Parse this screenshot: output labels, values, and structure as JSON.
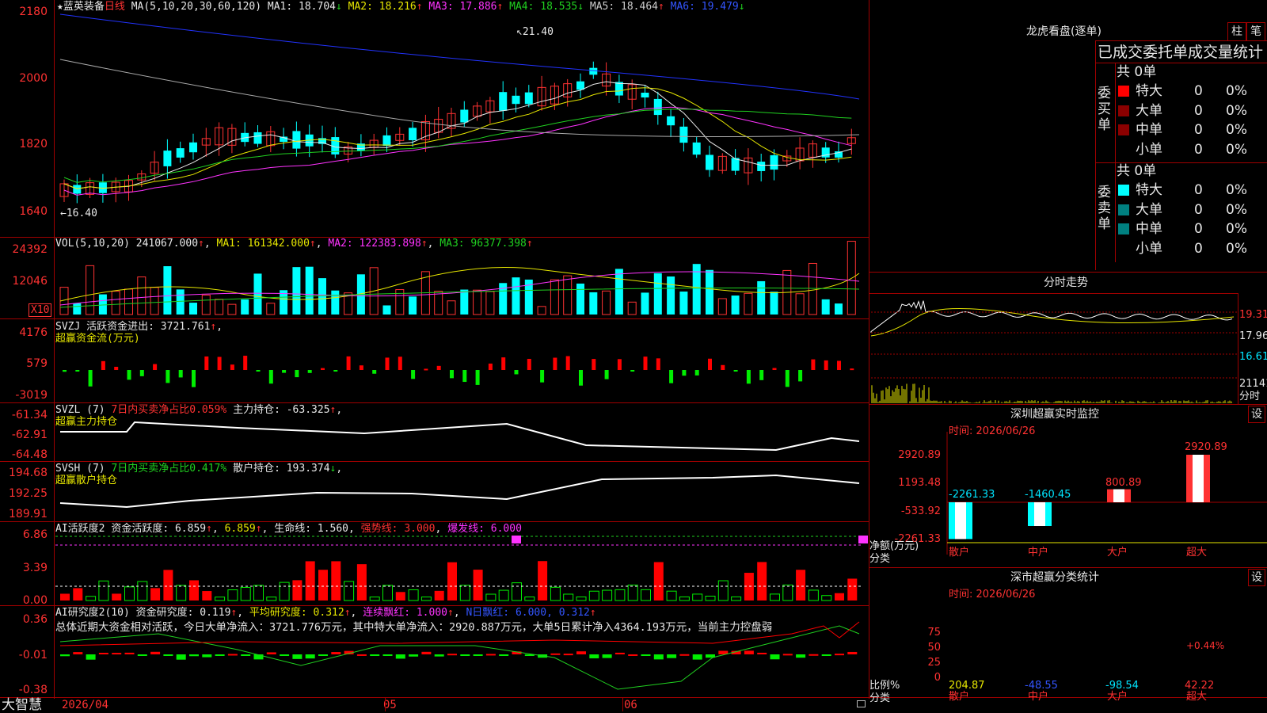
{
  "header": {
    "star": "★",
    "stock_name": "蓝英装备",
    "period": "日线",
    "ma_label": "MA(5,10,20,30,60,120)",
    "ma_values": [
      {
        "label": "MA1:",
        "value": "18.704",
        "arrow": "↓",
        "color": "#e8e8e8"
      },
      {
        "label": "MA2:",
        "value": "18.216",
        "arrow": "↑",
        "color": "#e6e600"
      },
      {
        "label": "MA3:",
        "value": "17.886",
        "arrow": "↑",
        "color": "#ff33ff"
      },
      {
        "label": "MA4:",
        "value": "18.535",
        "arrow": "↓",
        "color": "#20d020"
      },
      {
        "label": "MA5:",
        "value": "18.464",
        "arrow": "↑",
        "color": "#cccccc"
      },
      {
        "label": "MA6:",
        "value": "19.479",
        "arrow": "↓",
        "color": "#3355ff"
      }
    ],
    "high_mark": "21.40",
    "low_mark": "16.40"
  },
  "price_axis": [
    "2180",
    "2000",
    "1820",
    "1640"
  ],
  "vol": {
    "label": "VOL(5,10,20)",
    "value": "241067.000",
    "ma1": "MA1: 161342.000",
    "ma2": "MA2: 122383.898",
    "ma3": "MA3: 96377.398",
    "axis": [
      "24392",
      "12046"
    ],
    "unit": "X10"
  },
  "svzj": {
    "label": "SVZJ",
    "desc": "活跃资金进出: 3721.761",
    "sub": "超赢资金流(万元)",
    "axis": [
      "4176",
      "579",
      "-3019"
    ]
  },
  "svzl": {
    "label": "SVZL (7)",
    "ratio": "7日内买卖净占比0.059%",
    "hold": "主力持仓: -63.325",
    "sub": "超赢主力持仓",
    "axis": [
      "-61.34",
      "-62.91",
      "-64.48"
    ]
  },
  "svsh": {
    "label": "SVSH (7)",
    "ratio": "7日内买卖净占比0.417%",
    "hold": "散户持仓: 193.374",
    "sub": "超赢散户持仓",
    "axis": [
      "194.68",
      "192.25",
      "189.91"
    ]
  },
  "ai_active": {
    "label": "AI活跃度2",
    "desc": "资金活跃度: 6.859",
    "v2": "6.859",
    "life": "生命线: 1.560",
    "strong": "强势线: 3.000",
    "burst": "爆发线: 6.000",
    "axis": [
      "6.86",
      "3.39",
      "0.00"
    ]
  },
  "ai_research": {
    "label": "AI研究度2(10)",
    "desc": "资金研究度: 0.119",
    "avg": "平均研究度: 0.312",
    "cont": "连续飘红: 1.000",
    "nday": "N日飘红: 6.000, 0.312",
    "summary": "总体近期大资金相对活跃，今日大单净流入：3721.776万元，其中特大单净流入：2920.887万元，大单5日累计净入4364.193万元，当前主力控盘弱",
    "axis": [
      "0.36",
      "-0.01",
      "-0.38"
    ]
  },
  "footer": {
    "brand": "大智慧",
    "date": "2026/04",
    "m05": "05",
    "m06": "06"
  },
  "right": {
    "title": "龙虎看盘(逐单)",
    "btn_zhu": "柱",
    "btn_bi": "笔",
    "stats_title": "已成交委托单成交量统计",
    "buy_label": "委买单",
    "sell_label": "委卖单",
    "buy_total": "共 0单",
    "sell_total": "共 0单",
    "rows": [
      {
        "name": "特大",
        "count": "0",
        "pct": "0%"
      },
      {
        "name": "大单",
        "count": "0",
        "pct": "0%"
      },
      {
        "name": "中单",
        "count": "0",
        "pct": "0%"
      },
      {
        "name": "小单",
        "count": "0",
        "pct": "0%"
      }
    ],
    "intraday_title": "分时走势",
    "intraday_prices": [
      "19.31",
      "17.96",
      "16.61"
    ],
    "intraday_vol": "21141",
    "intraday_unit": "分时",
    "monitor_title": "深圳超赢实时监控",
    "settings": "设",
    "time_label": "时间: 2026/06/26",
    "monitor_axis": [
      "2920.89",
      "1193.48",
      "-533.92",
      "-2261.33"
    ],
    "monitor_unit1": "净额(万元)",
    "monitor_unit2": "分类",
    "categories": [
      "散户",
      "中户",
      "大户",
      "超大"
    ],
    "monitor_values": [
      -2261.33,
      -1460.45,
      800.89,
      2920.89
    ],
    "monitor_labels": [
      "-2261.33",
      "-1460.45",
      "800.89",
      "2920.89"
    ],
    "class_title": "深市超赢分类统计",
    "class_time": "时间: 2026/06/26",
    "class_axis": [
      "75",
      "50",
      "25",
      "0"
    ],
    "class_unit1": "比例%",
    "class_unit2": "分类",
    "class_values": [
      "204.87",
      "-48.55",
      "-98.54",
      "42.22"
    ],
    "class_bar_label": "+0.44%"
  }
}
